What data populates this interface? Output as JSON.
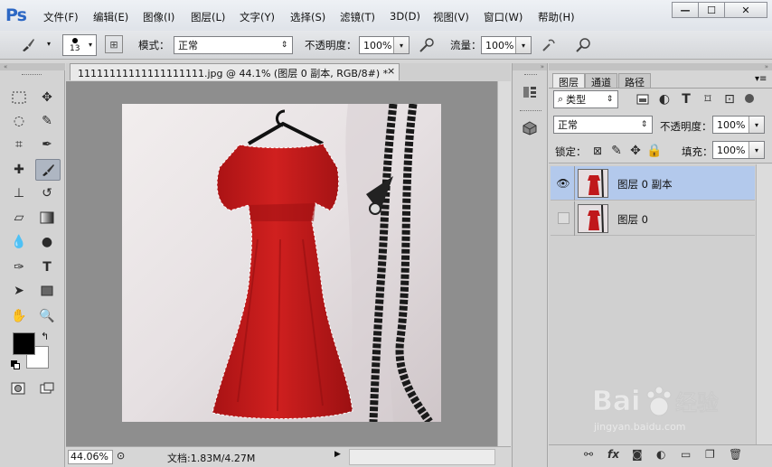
{
  "app": {
    "logo": "Ps"
  },
  "menu": [
    "文件(F)",
    "编辑(E)",
    "图像(I)",
    "图层(L)",
    "文字(Y)",
    "选择(S)",
    "滤镜(T)",
    "3D(D)",
    "视图(V)",
    "窗口(W)",
    "帮助(H)"
  ],
  "window_controls": {
    "minimize": "—",
    "restore": "☐",
    "close": "✕"
  },
  "options": {
    "brush_size": "13",
    "mode_label": "模式：",
    "mode_value": "正常",
    "opacity_label": "不透明度：",
    "opacity_value": "100%",
    "flow_label": "流量：",
    "flow_value": "100%"
  },
  "document": {
    "tab_title": "11111111111111111111.jpg @ 44.1% (图层 0 副本, RGB/8#) *",
    "tab_close": "×",
    "zoom": "44.06%",
    "doc_info": "文档:1.83M/4.27M"
  },
  "layers_panel": {
    "tabs": [
      "图层",
      "通道",
      "路径"
    ],
    "filter_kind": "类型",
    "blend_mode": "正常",
    "opacity_label": "不透明度：",
    "opacity_value": "100%",
    "lock_label": "锁定：",
    "fill_label": "填充：",
    "fill_value": "100%",
    "layers": [
      {
        "name": "图层 0 副本",
        "visible": true,
        "selected": true
      },
      {
        "name": "图层 0",
        "visible": false,
        "selected": false
      }
    ]
  },
  "colors": {
    "foreground": "#000000",
    "background": "#ffffff",
    "selected_layer": "#b3c9ec",
    "dress": "#c0181b"
  },
  "watermark": {
    "brand": "Baidu经验",
    "url": "jingyan.baidu.com"
  }
}
